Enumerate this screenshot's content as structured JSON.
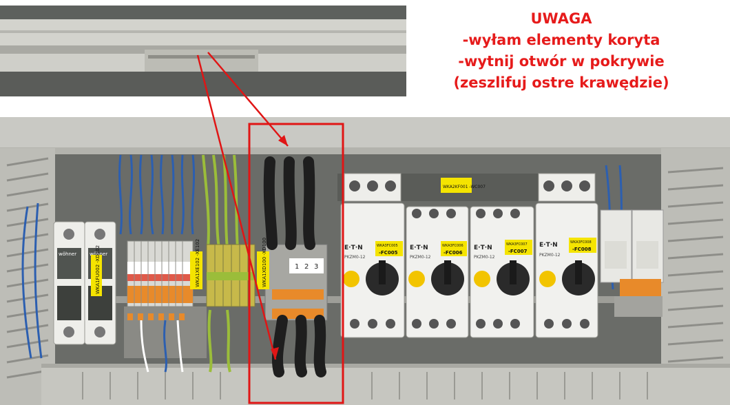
{
  "notice": {
    "title": "UWAGA",
    "line1": "-wyłam elementy koryta",
    "line2": "-wytnij otwór w pokrywie",
    "line3": "(zeszlifuj ostre krawędzie)"
  },
  "labels": {
    "fuse_brand_1": "wöhner",
    "fuse_brand_2": "wöhner",
    "fuse_tag": "WKA1FU002 -XD102",
    "terminal_tag_1": "WKA1XE102 -XE102",
    "terminal_tag_2": "WKA1XD100 -XD100",
    "term_num_1": "1",
    "term_num_2": "2",
    "term_num_3": "3",
    "contactor_tag": "WKA2KF001 -WC007",
    "brand": "E·T·N",
    "breaker_1_tag": "WKA3FC005",
    "breaker_1_id": "-FC005",
    "breaker_2_tag": "WKA3FC006",
    "breaker_2_id": "-FC006",
    "breaker_3_tag": "WKA3FC007",
    "breaker_3_id": "-FC007",
    "breaker_4_tag": "WKA3FC008",
    "breaker_4_id": "-FC008",
    "breaker_model": "PKZM0-12"
  },
  "colors": {
    "notice_text": "#e61b1b",
    "highlight_box": "#e01515",
    "arrows": "#e01515",
    "duct": "#c9c9c4",
    "breaker_body": "#f1f1ee",
    "knob": "#2a2a2a",
    "dial": "#f2c400",
    "tag": "#f5e400",
    "terminal_orange": "#e88a2a"
  }
}
